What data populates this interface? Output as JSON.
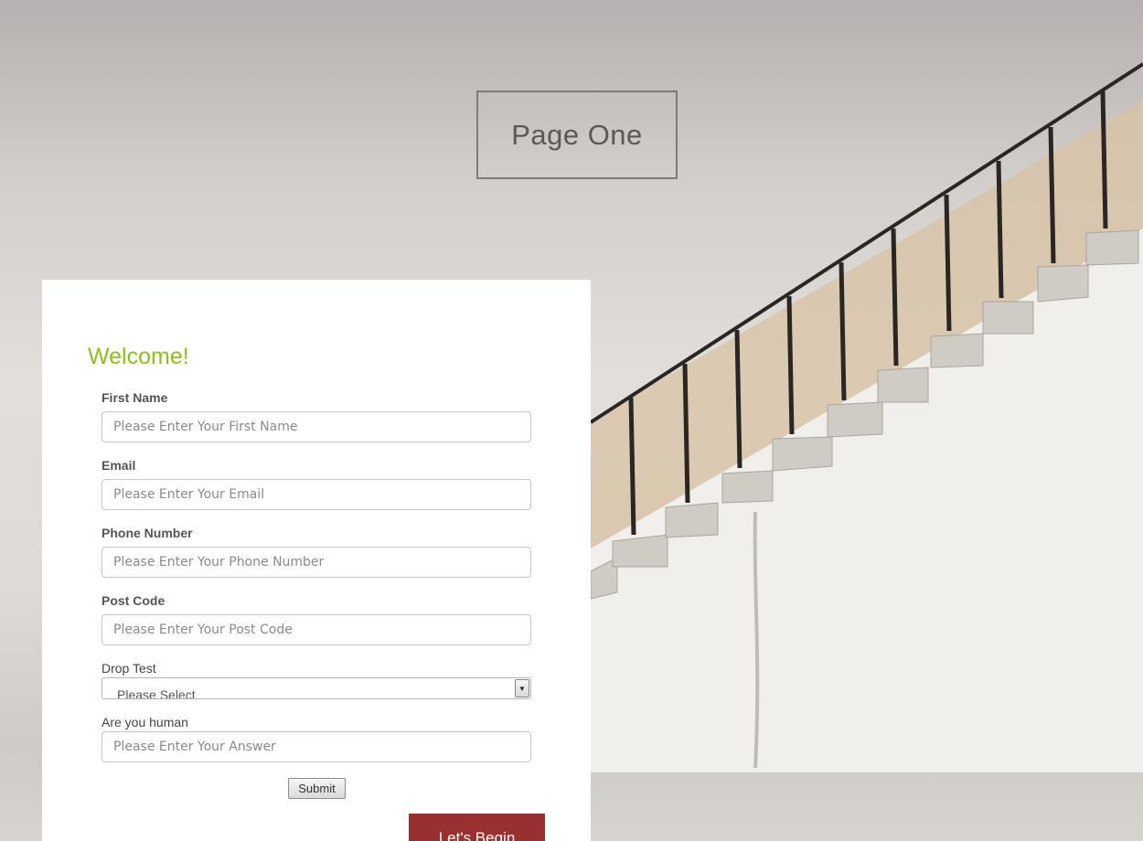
{
  "header": {
    "title": "Page One"
  },
  "form": {
    "welcome": "Welcome!",
    "fields": [
      {
        "label": "First Name",
        "placeholder": "Please Enter Your First Name"
      },
      {
        "label": "Email",
        "placeholder": "Please Enter Your Email"
      },
      {
        "label": "Phone Number",
        "placeholder": "Please Enter Your Phone Number"
      },
      {
        "label": "Post Code",
        "placeholder": "Please Enter Your Post Code"
      }
    ],
    "dropdown": {
      "label": "Drop Test",
      "selected": "Please Select"
    },
    "human": {
      "label": "Are you human",
      "placeholder": "Please Enter Your Answer"
    },
    "submit_label": "Submit",
    "begin_label": "Let's Begin"
  },
  "colors": {
    "welcome": "#8cbf1f",
    "begin_button": "#993030"
  }
}
